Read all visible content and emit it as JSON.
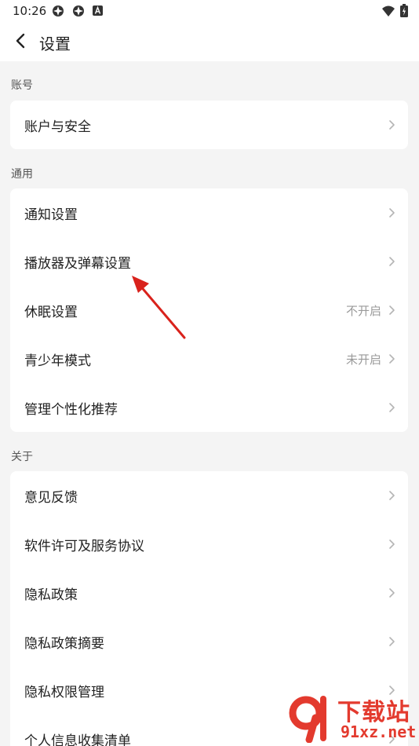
{
  "status": {
    "time": "10:26",
    "icons": [
      "app-notification-icon",
      "app-notification-icon",
      "a-icon",
      "wifi-icon",
      "battery-icon"
    ]
  },
  "header": {
    "title": "设置",
    "back_icon": "chevron-left-icon"
  },
  "sections": [
    {
      "label": "账号",
      "items": [
        {
          "label": "账户与安全",
          "value": ""
        }
      ]
    },
    {
      "label": "通用",
      "items": [
        {
          "label": "通知设置",
          "value": ""
        },
        {
          "label": "播放器及弹幕设置",
          "value": ""
        },
        {
          "label": "休眠设置",
          "value": "不开启"
        },
        {
          "label": "青少年模式",
          "value": "未开启"
        },
        {
          "label": "管理个性化推荐",
          "value": ""
        }
      ]
    },
    {
      "label": "关于",
      "items": [
        {
          "label": "意见反馈",
          "value": ""
        },
        {
          "label": "软件许可及服务协议",
          "value": ""
        },
        {
          "label": "隐私政策",
          "value": ""
        },
        {
          "label": "隐私政策摘要",
          "value": ""
        },
        {
          "label": "隐私权限管理",
          "value": ""
        },
        {
          "label": "个人信息收集清单",
          "value": ""
        }
      ]
    }
  ],
  "watermark": {
    "main": "下载站",
    "sub": "91xz.net"
  },
  "colors": {
    "background": "#f4f4f4",
    "card": "#ffffff",
    "annotation_arrow": "#d9221c",
    "watermark": "#e33a2e"
  }
}
